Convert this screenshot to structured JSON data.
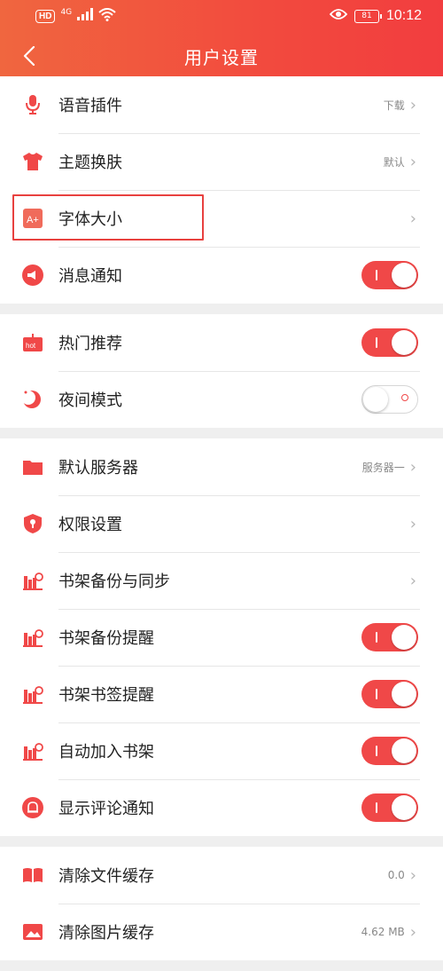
{
  "status_bar": {
    "network_badge": "HD",
    "signal_type": "4G",
    "battery": "81",
    "time": "10:12"
  },
  "header": {
    "title": "用户设置"
  },
  "groups": [
    {
      "items": [
        {
          "label": "语音插件",
          "value": "下载",
          "control": "chevron",
          "icon": "microphone-icon"
        },
        {
          "label": "主题换肤",
          "value": "默认",
          "control": "chevron",
          "icon": "tshirt-icon"
        },
        {
          "label": "字体大小",
          "value": "",
          "control": "chevron",
          "icon": "font-size-icon",
          "highlighted": true
        },
        {
          "label": "消息通知",
          "control": "toggle",
          "state": "on",
          "icon": "megaphone-icon"
        }
      ]
    },
    {
      "items": [
        {
          "label": "热门推荐",
          "control": "toggle",
          "state": "on",
          "icon": "hot-icon",
          "icon_text": "hot"
        },
        {
          "label": "夜间模式",
          "control": "toggle",
          "state": "off",
          "icon": "moon-icon"
        }
      ]
    },
    {
      "items": [
        {
          "label": "默认服务器",
          "value": "服务器一",
          "control": "chevron",
          "icon": "folder-icon"
        },
        {
          "label": "权限设置",
          "value": "",
          "control": "chevron",
          "icon": "shield-icon"
        },
        {
          "label": "书架备份与同步",
          "value": "",
          "control": "chevron",
          "icon": "bookshelf-icon"
        },
        {
          "label": "书架备份提醒",
          "control": "toggle",
          "state": "on",
          "icon": "bookshelf-icon"
        },
        {
          "label": "书架书签提醒",
          "control": "toggle",
          "state": "on",
          "icon": "bookshelf-icon"
        },
        {
          "label": "自动加入书架",
          "control": "toggle",
          "state": "on",
          "icon": "bookshelf-icon"
        },
        {
          "label": "显示评论通知",
          "control": "toggle",
          "state": "on",
          "icon": "bell-icon"
        }
      ]
    },
    {
      "items": [
        {
          "label": "清除文件缓存",
          "value": "0.0",
          "control": "chevron",
          "icon": "book-icon"
        },
        {
          "label": "清除图片缓存",
          "value": "4.62 MB",
          "control": "chevron",
          "icon": "image-icon"
        }
      ]
    }
  ],
  "colors": {
    "accent": "#f04848",
    "header_start": "#f0663f",
    "header_end": "#f23d3f"
  }
}
